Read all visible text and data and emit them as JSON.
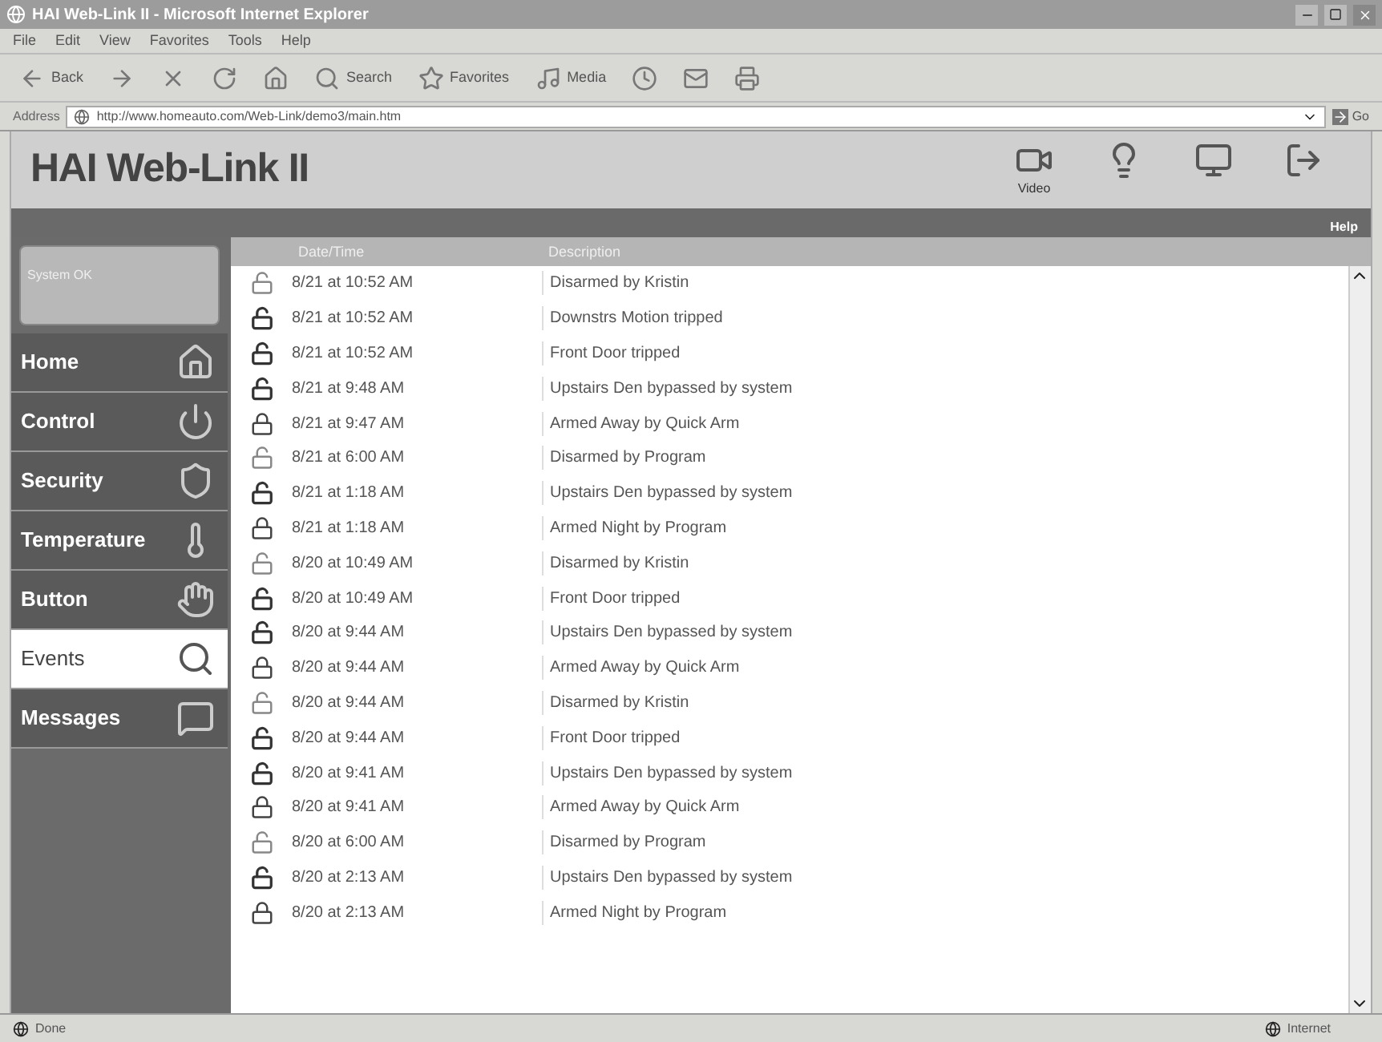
{
  "window": {
    "title": "HAI Web-Link II - Microsoft Internet Explorer"
  },
  "menu": [
    "File",
    "Edit",
    "View",
    "Favorites",
    "Tools",
    "Help"
  ],
  "toolbar": [
    {
      "kind": "back",
      "label": "Back"
    },
    {
      "kind": "forward"
    },
    {
      "kind": "stop"
    },
    {
      "kind": "refresh"
    },
    {
      "kind": "home"
    },
    {
      "kind": "search",
      "label": "Search"
    },
    {
      "kind": "favorites",
      "label": "Favorites"
    },
    {
      "kind": "media",
      "label": "Media"
    },
    {
      "kind": "history"
    },
    {
      "kind": "mail"
    },
    {
      "kind": "print"
    }
  ],
  "address": {
    "label": "Address",
    "value": "http://www.homeauto.com/Web-Link/demo3/main.htm",
    "go": "Go"
  },
  "app": {
    "title": "HAI Web-Link II",
    "help": "Help",
    "header_icons": [
      {
        "kind": "video",
        "label": "Video"
      },
      {
        "kind": "scenes"
      },
      {
        "kind": "computer"
      },
      {
        "kind": "logout"
      }
    ]
  },
  "status_box": {
    "text": "System OK"
  },
  "nav": [
    {
      "label": "Home",
      "kind": "home",
      "selected": false
    },
    {
      "label": "Control",
      "kind": "control",
      "selected": false
    },
    {
      "label": "Security",
      "kind": "security",
      "selected": false
    },
    {
      "label": "Temperature",
      "kind": "temperature",
      "selected": false
    },
    {
      "label": "Button",
      "kind": "button",
      "selected": false
    },
    {
      "label": "Events",
      "kind": "events",
      "selected": true
    },
    {
      "label": "Messages",
      "kind": "messages",
      "selected": false
    }
  ],
  "table": {
    "columns": [
      "Date/Time",
      "Description"
    ],
    "rows": [
      {
        "kind": "open",
        "time": "8/21 at 10:52 AM",
        "description": "Disarmed by Kristin"
      },
      {
        "kind": "tripped",
        "time": "8/21 at 10:52 AM",
        "description": "Downstrs Motion tripped"
      },
      {
        "kind": "tripped",
        "time": "8/21 at 10:52 AM",
        "description": "Front Door tripped"
      },
      {
        "kind": "tripped",
        "time": "8/21 at 9:48 AM",
        "description": "Upstairs Den bypassed by system"
      },
      {
        "kind": "armed",
        "time": "8/21 at 9:47 AM",
        "description": "Armed Away by Quick Arm"
      },
      {
        "kind": "open",
        "time": "8/21 at 6:00 AM",
        "description": "Disarmed by Program"
      },
      {
        "kind": "tripped",
        "time": "8/21 at 1:18 AM",
        "description": "Upstairs Den bypassed by system"
      },
      {
        "kind": "armed",
        "time": "8/21 at 1:18 AM",
        "description": "Armed Night by Program"
      },
      {
        "kind": "open",
        "time": "8/20 at 10:49 AM",
        "description": "Disarmed by Kristin"
      },
      {
        "kind": "tripped",
        "time": "8/20 at 10:49 AM",
        "description": "Front Door tripped"
      },
      {
        "kind": "tripped",
        "time": "8/20 at 9:44 AM",
        "description": "Upstairs Den bypassed by system"
      },
      {
        "kind": "armed",
        "time": "8/20 at 9:44 AM",
        "description": "Armed Away by Quick Arm"
      },
      {
        "kind": "open",
        "time": "8/20 at 9:44 AM",
        "description": "Disarmed by Kristin"
      },
      {
        "kind": "tripped",
        "time": "8/20 at 9:44 AM",
        "description": "Front Door tripped"
      },
      {
        "kind": "tripped",
        "time": "8/20 at 9:41 AM",
        "description": "Upstairs Den bypassed by system"
      },
      {
        "kind": "armed",
        "time": "8/20 at 9:41 AM",
        "description": "Armed Away by Quick Arm"
      },
      {
        "kind": "open",
        "time": "8/20 at 6:00 AM",
        "description": "Disarmed by Program"
      },
      {
        "kind": "tripped",
        "time": "8/20 at 2:13 AM",
        "description": "Upstairs Den bypassed by system"
      },
      {
        "kind": "armed",
        "time": "8/20 at 2:13 AM",
        "description": "Armed Night by Program"
      }
    ]
  },
  "status_bar": {
    "left": "Done",
    "right": "Internet"
  }
}
